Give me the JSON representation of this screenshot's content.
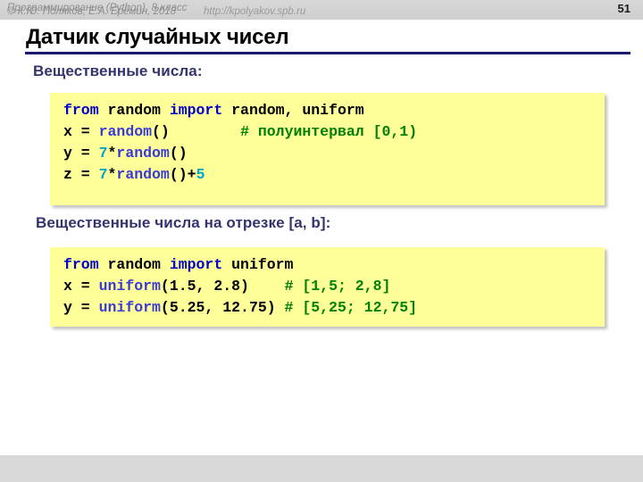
{
  "header": {
    "course_title": "Программирование (Python), 8 класс",
    "page_number": "51",
    "band_color": "#d2d2d2"
  },
  "slide": {
    "title": "Датчик случайных чисел",
    "rule_color": "#1a1a6e",
    "subheading_1": "Вещественные числа:",
    "subheading_2": "Вещественные числа на отрезке [a, b]:",
    "subheading_color": "#33336e"
  },
  "code_blocks": [
    {
      "id": "code-block-real-numbers",
      "background": "#ffff99",
      "lines": [
        [
          {
            "t": "from ",
            "c": "kw"
          },
          {
            "t": "random ",
            "c": "plain"
          },
          {
            "t": "import ",
            "c": "kw"
          },
          {
            "t": "random, uniform",
            "c": "plain"
          }
        ],
        [
          {
            "t": "x = ",
            "c": "plain"
          },
          {
            "t": "random",
            "c": "fn"
          },
          {
            "t": "()",
            "c": "plain"
          },
          {
            "t": "        ",
            "c": "plain"
          },
          {
            "t": "# полуинтервал [0,1)",
            "c": "cmt"
          }
        ],
        [
          {
            "t": "y = ",
            "c": "plain"
          },
          {
            "t": "7",
            "c": "num"
          },
          {
            "t": "*",
            "c": "plain"
          },
          {
            "t": "random",
            "c": "fn"
          },
          {
            "t": "()",
            "c": "plain"
          }
        ],
        [
          {
            "t": "z = ",
            "c": "plain"
          },
          {
            "t": "7",
            "c": "num"
          },
          {
            "t": "*",
            "c": "plain"
          },
          {
            "t": "random",
            "c": "fn"
          },
          {
            "t": "()+",
            "c": "plain"
          },
          {
            "t": "5",
            "c": "num"
          }
        ]
      ]
    },
    {
      "id": "code-block-interval",
      "background": "#ffff99",
      "lines": [
        [
          {
            "t": "from ",
            "c": "kw"
          },
          {
            "t": "random ",
            "c": "plain"
          },
          {
            "t": "import ",
            "c": "kw"
          },
          {
            "t": "uniform",
            "c": "plain"
          }
        ],
        [
          {
            "t": "x = ",
            "c": "plain"
          },
          {
            "t": "uniform",
            "c": "fn"
          },
          {
            "t": "(1.5, 2.8)",
            "c": "plain"
          },
          {
            "t": "    ",
            "c": "plain"
          },
          {
            "t": "# [1,5; 2,8]",
            "c": "cmt"
          }
        ],
        [
          {
            "t": "y = ",
            "c": "plain"
          },
          {
            "t": "uniform",
            "c": "fn"
          },
          {
            "t": "(5.25, 12.75) ",
            "c": "plain"
          },
          {
            "t": "# [5,25; 12,75]",
            "c": "cmt"
          }
        ]
      ]
    }
  ],
  "footer": {
    "copyright": "© К.Ю. Поляков, Е.А. Ерёмин, 2018",
    "url": "http://kpolyakov.spb.ru",
    "band_color": "#d9d9d9"
  }
}
